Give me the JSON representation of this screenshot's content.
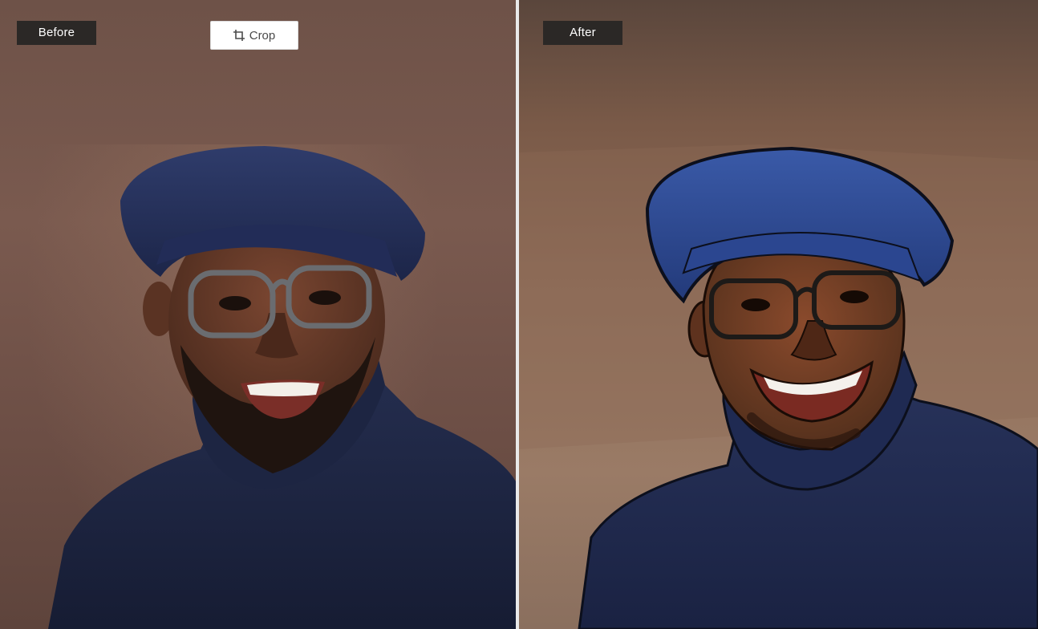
{
  "comparison": {
    "before_label": "Before",
    "after_label": "After"
  },
  "toolbar": {
    "crop_label": "Crop",
    "crop_icon": "crop-icon"
  },
  "colors": {
    "badge_bg": "#2b2826",
    "badge_text": "#ffffff",
    "sweater_navy": "#1e2746",
    "cap_navy": "#243262",
    "skin_dark": "#5a3424",
    "backdrop_brown": "#6e5248"
  }
}
